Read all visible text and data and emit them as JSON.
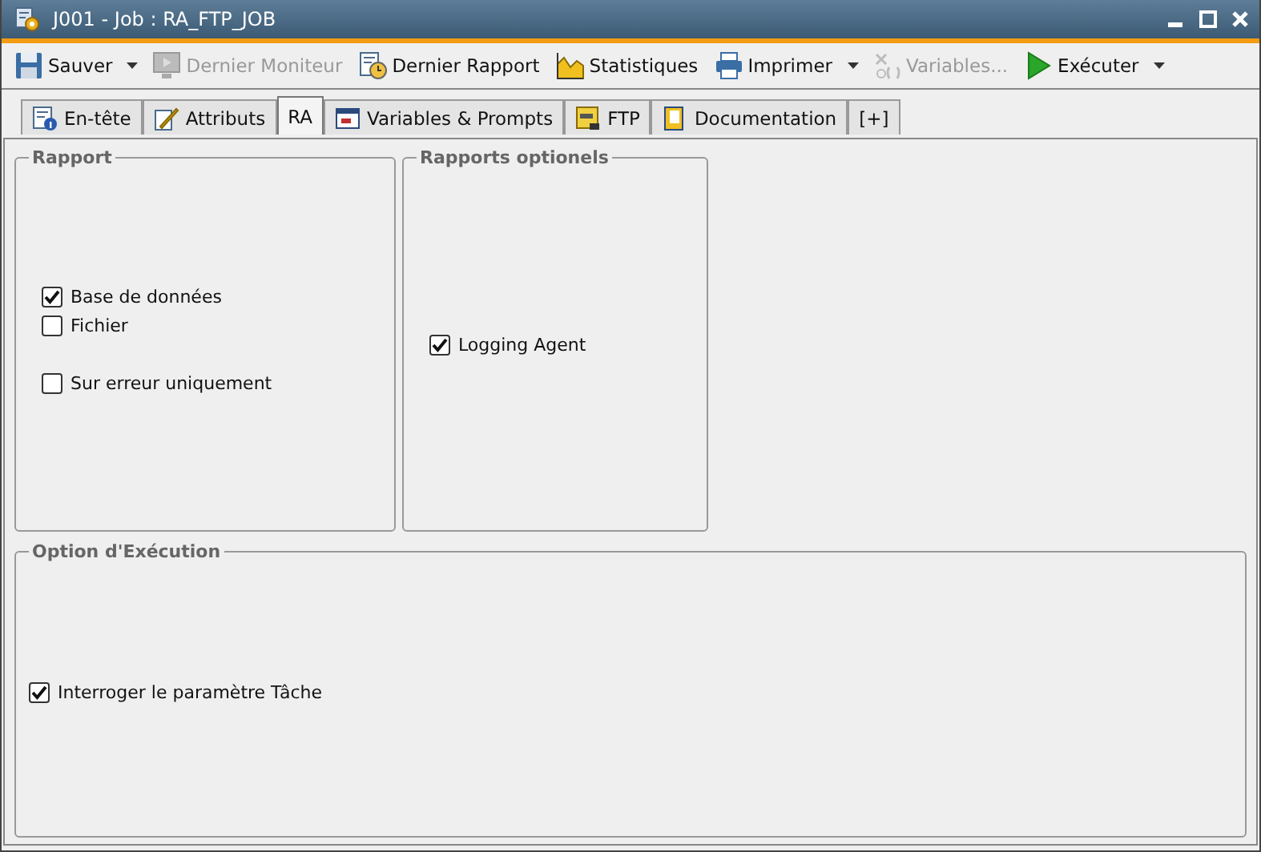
{
  "window": {
    "title": "J001 - Job : RA_FTP_JOB"
  },
  "toolbar": [
    {
      "kind": "save",
      "label": "Sauver",
      "disabled": false,
      "dropdown": true
    },
    {
      "kind": "monitor",
      "label": "Dernier Moniteur",
      "disabled": true,
      "dropdown": false
    },
    {
      "kind": "report",
      "label": "Dernier Rapport",
      "disabled": false,
      "dropdown": false
    },
    {
      "kind": "stats",
      "label": "Statistiques",
      "disabled": false,
      "dropdown": false
    },
    {
      "kind": "print",
      "label": "Imprimer",
      "disabled": false,
      "dropdown": true
    },
    {
      "kind": "variables",
      "label": "Variables...",
      "disabled": true,
      "dropdown": false
    },
    {
      "kind": "run",
      "label": "Exécuter",
      "disabled": false,
      "dropdown": true
    }
  ],
  "tabs": [
    {
      "kind": "header",
      "label": "En-tête",
      "selected": false
    },
    {
      "kind": "attributes",
      "label": "Attributs",
      "selected": false
    },
    {
      "kind": "none",
      "label": "RA",
      "selected": true
    },
    {
      "kind": "variables",
      "label": "Variables & Prompts",
      "selected": false
    },
    {
      "kind": "ftp",
      "label": "FTP",
      "selected": false
    },
    {
      "kind": "doc",
      "label": "Documentation",
      "selected": false
    },
    {
      "kind": "add",
      "label": "[+]",
      "selected": false
    }
  ],
  "groups": [
    {
      "title": "Rapport",
      "options": [
        {
          "label": "Base de données",
          "checked": true
        },
        {
          "label": "Fichier",
          "checked": false
        },
        {
          "label": "Sur erreur uniquement",
          "checked": false
        }
      ]
    },
    {
      "title": "Rapports optionels",
      "options": [
        {
          "label": "Logging Agent",
          "checked": true
        }
      ]
    },
    {
      "title": "Option d'Exécution",
      "options": [
        {
          "label": "Interroger le paramètre Tâche",
          "checked": true
        }
      ]
    }
  ]
}
